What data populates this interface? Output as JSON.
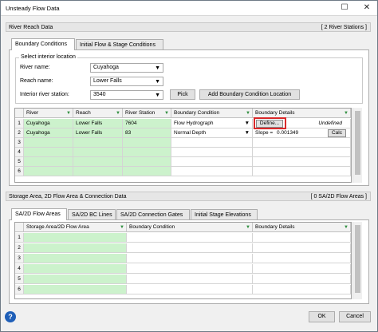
{
  "window": {
    "title": "Unsteady Flow Data",
    "close_glyph": "✕",
    "maximize_glyph": "☐"
  },
  "river_reach": {
    "section_label": "River Reach Data",
    "count_label": "[ 2 River Stations ]",
    "tabs": [
      {
        "label": "Boundary Conditions",
        "active": true
      },
      {
        "label": "Initial Flow & Stage Conditions",
        "active": false
      }
    ],
    "location_group": {
      "title": "Select interior location",
      "river_label": "River name:",
      "river_value": "Cuyahoga",
      "reach_label": "Reach name:",
      "reach_value": "Lower Falls",
      "station_label": "Interior river station:",
      "station_value": "3540",
      "pick_button": "Pick",
      "add_button": "Add Boundary Condition Location"
    },
    "grid": {
      "headers": [
        "River",
        "Reach",
        "River Station",
        "Boundary Condition",
        "Boundary Details"
      ],
      "rows": [
        {
          "num": "1",
          "river": "Cuyahoga",
          "reach": "Lower Falls",
          "station": "7604",
          "condition": "Flow Hydrograph",
          "details_button": "Define...",
          "details_text": "Undefined"
        },
        {
          "num": "2",
          "river": "Cuyahoga",
          "reach": "Lower Falls",
          "station": "83",
          "condition": "Normal Depth",
          "slope_label": "Slope =",
          "slope_value": "0.001349",
          "calc_button": "Calc"
        },
        {
          "num": "3"
        },
        {
          "num": "4"
        },
        {
          "num": "5"
        },
        {
          "num": "6"
        }
      ]
    }
  },
  "storage": {
    "section_label": "Storage Area, 2D Flow Area & Connection Data",
    "count_label": "[ 0 SA/2D Flow Areas ]",
    "tabs": [
      {
        "label": "SA/2D Flow Areas",
        "active": true
      },
      {
        "label": "SA/2D BC Lines",
        "active": false
      },
      {
        "label": "SA/2D Connection Gates",
        "active": false
      },
      {
        "label": "Initial Stage Elevations",
        "active": false
      }
    ],
    "grid": {
      "headers": [
        "Storage Area/2D Flow Area",
        "Boundary Condition",
        "Boundary Details"
      ],
      "rows": [
        {
          "num": "1"
        },
        {
          "num": "2"
        },
        {
          "num": "3"
        },
        {
          "num": "4"
        },
        {
          "num": "5"
        },
        {
          "num": "6"
        }
      ]
    }
  },
  "footer": {
    "ok": "OK",
    "cancel": "Cancel",
    "help_glyph": "?"
  },
  "icons": {
    "filter_icon": "filter-icon",
    "dropdown_icon": "chevron-down-icon"
  },
  "colors": {
    "green_cell": "#ccf2cc",
    "highlight": "#d9292a",
    "help_icon": "#1f5fb8"
  }
}
